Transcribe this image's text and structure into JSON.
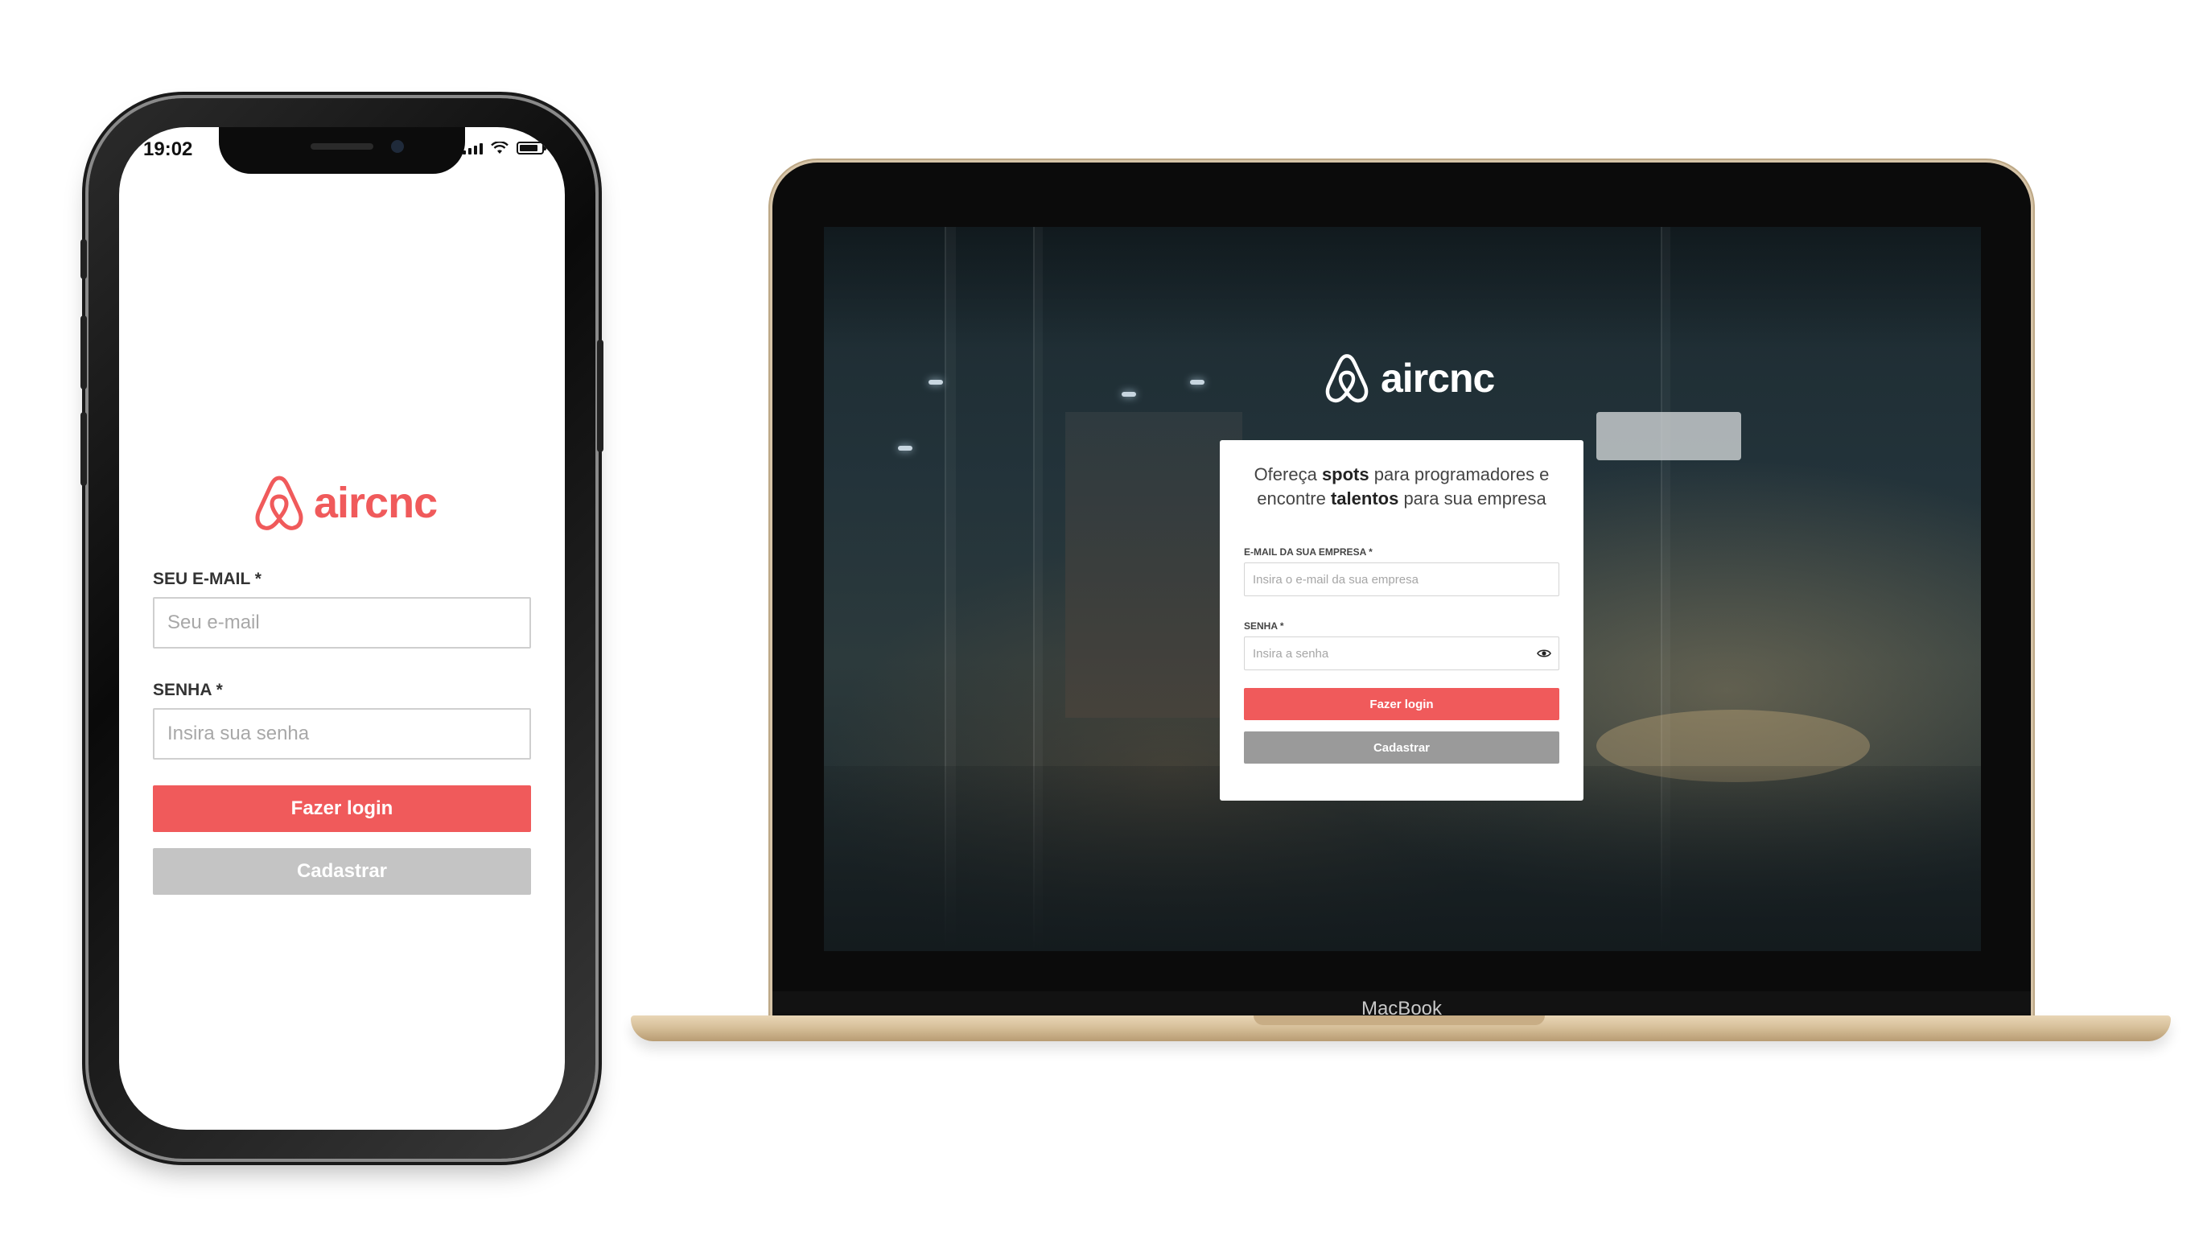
{
  "mobile": {
    "status_time": "19:02",
    "brand": "aircnc",
    "email_label": "SEU E-MAIL *",
    "email_placeholder": "Seu e-mail",
    "password_label": "SENHA *",
    "password_placeholder": "Insira sua senha",
    "login_label": "Fazer login",
    "register_label": "Cadastrar"
  },
  "desktop": {
    "brand": "aircnc",
    "headline_part1": "Ofereça ",
    "headline_bold1": "spots",
    "headline_part2": " para programadores e encontre ",
    "headline_bold2": "talentos",
    "headline_part3": " para sua empresa",
    "email_label": "E-MAIL DA SUA EMPRESA *",
    "email_placeholder": "Insira o e-mail da sua empresa",
    "password_label": "SENHA *",
    "password_placeholder": "Insira a senha",
    "login_label": "Fazer login",
    "register_label": "Cadastrar"
  },
  "device": {
    "laptop_label": "MacBook"
  },
  "colors": {
    "brand": "#f05a5b",
    "mobile_secondary": "#c4c4c4",
    "desktop_secondary": "#9a9a9a"
  },
  "icons": {
    "brand_logo": "airbnb-belo-logo-icon",
    "password_toggle": "eye-icon",
    "signal": "cellular-signal-icon",
    "wifi": "wifi-icon",
    "battery": "battery-icon"
  }
}
